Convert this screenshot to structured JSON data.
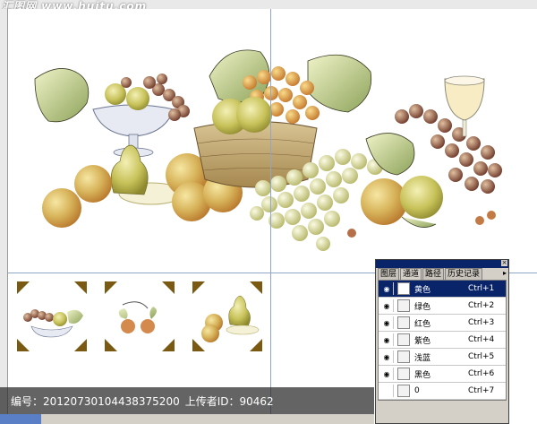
{
  "watermark_top": "汇图网 www.huitu.com",
  "caption": {
    "id_label": "编号：",
    "id_value": "20120730104438375200",
    "uploader_label": "上传者ID：",
    "uploader_value": "90462"
  },
  "palette": {
    "tabs": [
      "图层",
      "通道",
      "路径",
      "历史记录"
    ],
    "channels": [
      {
        "name": "黄色",
        "shortcut": "Ctrl+1",
        "visible": true,
        "selected": true
      },
      {
        "name": "绿色",
        "shortcut": "Ctrl+2",
        "visible": true,
        "selected": false
      },
      {
        "name": "红色",
        "shortcut": "Ctrl+3",
        "visible": true,
        "selected": false
      },
      {
        "name": "紫色",
        "shortcut": "Ctrl+4",
        "visible": true,
        "selected": false
      },
      {
        "name": "浅蓝",
        "shortcut": "Ctrl+5",
        "visible": true,
        "selected": false
      },
      {
        "name": "黑色",
        "shortcut": "Ctrl+6",
        "visible": true,
        "selected": false
      },
      {
        "name": "0",
        "shortcut": "Ctrl+7",
        "visible": false,
        "selected": false
      }
    ]
  },
  "colors": {
    "selection": "#0a246a",
    "panel": "#d4d0c8",
    "guide": "#8fa6c8"
  }
}
